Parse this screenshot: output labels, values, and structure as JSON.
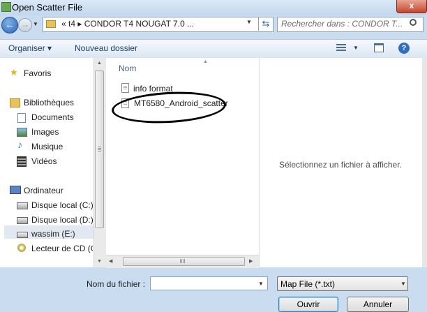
{
  "window": {
    "title": "Open Scatter File",
    "close_glyph": "x"
  },
  "nav_buttons": {
    "back_glyph": "←",
    "forward_glyph": "→"
  },
  "address": {
    "crumbs": "«  t4  ▸  CONDOR T4 NOUGAT 7.0 ..."
  },
  "search": {
    "placeholder": "Rechercher dans : CONDOR T..."
  },
  "toolbar": {
    "organize_label": "Organiser ▾",
    "new_folder_label": "Nouveau dossier",
    "help_glyph": "?"
  },
  "sidebar": {
    "items": [
      {
        "label": "Favoris",
        "icon": "star-icon"
      },
      {
        "label": "Bibliothèques",
        "icon": "library-icon"
      },
      {
        "label": "Documents",
        "icon": "document-icon"
      },
      {
        "label": "Images",
        "icon": "image-icon"
      },
      {
        "label": "Musique",
        "icon": "music-icon"
      },
      {
        "label": "Vidéos",
        "icon": "video-icon"
      },
      {
        "label": "Ordinateur",
        "icon": "computer-icon"
      },
      {
        "label": "Disque local (C:)",
        "icon": "drive-icon"
      },
      {
        "label": "Disque local (D:)",
        "icon": "drive-icon"
      },
      {
        "label": "wassim (E:)",
        "icon": "usb-drive-icon",
        "selected": true
      },
      {
        "label": "Lecteur de CD (G",
        "icon": "cd-drive-icon"
      }
    ]
  },
  "file_list": {
    "column_header": "Nom",
    "files": [
      {
        "name": "info format"
      },
      {
        "name": "MT6580_Android_scatter",
        "circled": true
      }
    ]
  },
  "preview": {
    "message": "Sélectionnez un fichier à afficher."
  },
  "bottom": {
    "filename_label": "Nom du fichier :",
    "filename_value": "",
    "filter_value": "Map File (*.txt)",
    "open_label": "Ouvrir",
    "cancel_label": "Annuler"
  },
  "colors": {
    "accent": "#2b67b5",
    "titlebar": "#c3d7ee",
    "close": "#c5452c"
  }
}
